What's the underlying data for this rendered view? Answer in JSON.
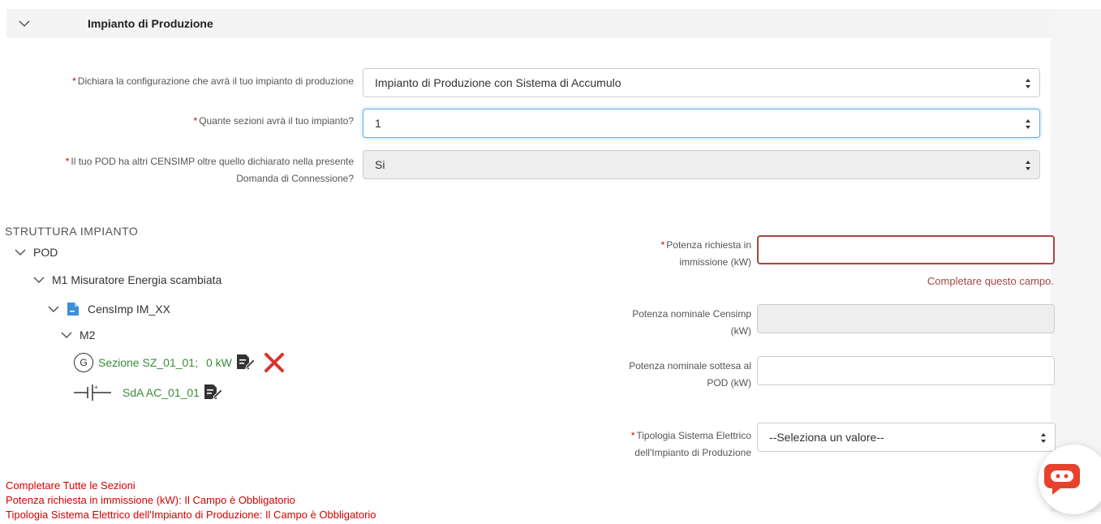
{
  "header": {
    "title": "Impianto di Produzione"
  },
  "form": {
    "configurazione": {
      "label": "Dichiara la configurazione che avrà il tuo impianto di produzione",
      "value": "Impianto di Produzione con Sistema di Accumulo"
    },
    "sezioni": {
      "label": "Quante sezioni avrà il tuo impianto?",
      "value": "1"
    },
    "censimp": {
      "label_line1": "Il tuo POD ha altri CENSIMP oltre quello dichiarato nella presente",
      "label_line2": "Domanda di Connessione?",
      "value": "Si"
    }
  },
  "tree": {
    "title": "STRUTTURA IMPIANTO",
    "pod": "POD",
    "m1": "M1 Misuratore Energia scambiata",
    "censimp": "CensImp IM_XX",
    "m2": "M2",
    "generator_symbol": "G",
    "sezione": "Sezione SZ_01_01;",
    "sezione_kw": "0 kW",
    "sda": "SdA AC_01_01"
  },
  "right": {
    "potenza_richiesta": {
      "label_line1": "Potenza richiesta in",
      "label_line2": "immissione (kW)",
      "error": "Completare questo campo."
    },
    "potenza_censimp": {
      "label_line1": "Potenza nominale Censimp",
      "label_line2": "(kW)"
    },
    "potenza_pod": {
      "label_line1": "Potenza nominale sottesa al",
      "label_line2": "POD (kW)"
    },
    "tipologia": {
      "label_line1": "Tipologia Sistema Elettrico",
      "label_line2": "dell'Impianto di Produzione",
      "value": "--Seleziona un valore--"
    }
  },
  "messages": [
    "Completare Tutte le Sezioni",
    "Potenza richiesta in immissione (kW): Il Campo è Obbligatorio",
    "Tipologia Sistema Elettrico dell'Impianto di Produzione: Il Campo è Obbligatorio"
  ],
  "colors": {
    "error": "#a94442",
    "required": "#cc0000",
    "green": "#3a8a3a",
    "delete": "#d9342b",
    "chat": "#e8412c"
  }
}
